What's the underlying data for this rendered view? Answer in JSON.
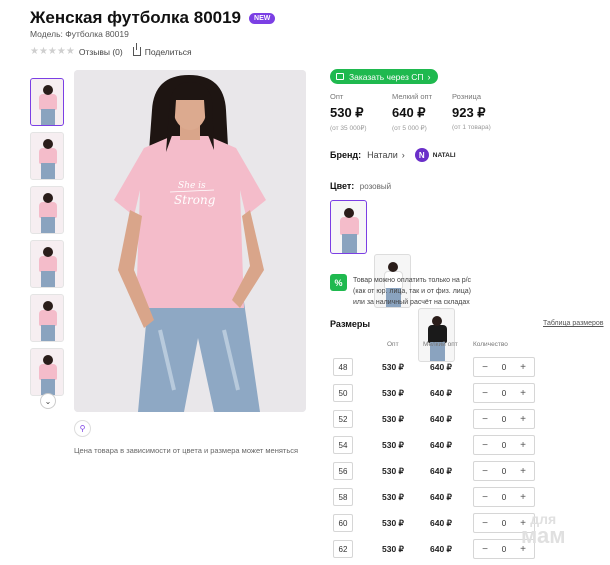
{
  "product": {
    "title": "Женская футболка 80019",
    "badge": "NEW",
    "model": "Модель: Футболка 80019",
    "rating_stars": 0,
    "reviews_label": "Отзывы (0)",
    "share_label": "Поделиться"
  },
  "gallery": {
    "thumbnail_count": 6,
    "price_note": "Цена товара в зависимости от цвета и размера может меняться"
  },
  "purchase": {
    "sp_button": "Заказать через СП",
    "prices": [
      {
        "label": "Опт",
        "value": "530 ₽",
        "sub": "(от 35 000₽)"
      },
      {
        "label": "Мелкий опт",
        "value": "640 ₽",
        "sub": "(от 5 000 ₽)"
      },
      {
        "label": "Розница",
        "value": "923 ₽",
        "sub": "(от 1 товара)"
      }
    ]
  },
  "brand": {
    "label": "Бренд:",
    "value": "Натали",
    "logo_letter": "N",
    "logo_text": "NATALI"
  },
  "color": {
    "label": "Цвет:",
    "value": "розовый",
    "swatches": [
      {
        "shirt_color": "#f4bcca"
      },
      {
        "shirt_color": "#ffffff"
      },
      {
        "shirt_color": "#1a1a1a"
      }
    ]
  },
  "payment": {
    "icon_text": "%",
    "lines": [
      "Товар можно оплатить только на р/с",
      "(как от юр. лица, так и от физ. лица)",
      "или за наличный расчёт на складах"
    ]
  },
  "sizes": {
    "title": "Размеры",
    "table_link": "Таблица размеров",
    "headers": {
      "opt": "Опт",
      "small_opt": "Мелкий опт",
      "qty": "Количество"
    },
    "rows": [
      {
        "size": "48",
        "opt": "530 ₽",
        "small_opt": "640 ₽",
        "qty": "0"
      },
      {
        "size": "50",
        "opt": "530 ₽",
        "small_opt": "640 ₽",
        "qty": "0"
      },
      {
        "size": "52",
        "opt": "530 ₽",
        "small_opt": "640 ₽",
        "qty": "0"
      },
      {
        "size": "54",
        "opt": "530 ₽",
        "small_opt": "640 ₽",
        "qty": "0"
      },
      {
        "size": "56",
        "opt": "530 ₽",
        "small_opt": "640 ₽",
        "qty": "0"
      },
      {
        "size": "58",
        "opt": "530 ₽",
        "small_opt": "640 ₽",
        "qty": "0"
      },
      {
        "size": "60",
        "opt": "530 ₽",
        "small_opt": "640 ₽",
        "qty": "0"
      },
      {
        "size": "62",
        "opt": "530 ₽",
        "small_opt": "640 ₽",
        "qty": "0"
      }
    ],
    "minus": "−",
    "plus": "+"
  },
  "photo": {
    "print_line1": "She is",
    "print_line2": "Strong"
  },
  "watermark": {
    "line1": "для",
    "line2": "мам"
  },
  "colors": {
    "accent": "#7b3fe4",
    "green": "#1fb94f",
    "shirt": "#f4bcca"
  },
  "icons": [
    "star-icon",
    "share-icon",
    "chevron-down-icon",
    "zoom-icon",
    "cart-icon",
    "chevron-right-icon",
    "percent-icon",
    "minus-icon",
    "plus-icon"
  ]
}
